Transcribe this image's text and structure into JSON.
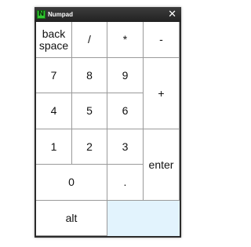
{
  "window": {
    "title": "Numpad",
    "app_icon_glyph": "N",
    "close_glyph": "✕"
  },
  "keys": {
    "backspace": "back\nspace",
    "divide": "/",
    "multiply": "*",
    "minus": "-",
    "seven": "7",
    "eight": "8",
    "nine": "9",
    "plus": "+",
    "four": "4",
    "five": "5",
    "six": "6",
    "one": "1",
    "two": "2",
    "three": "3",
    "enter": "enter",
    "zero": "0",
    "decimal": ".",
    "alt": "alt"
  },
  "colors": {
    "titlebar": "#2b2b2b",
    "icon": "#32c832",
    "empty_area": "#e2f3fd"
  }
}
